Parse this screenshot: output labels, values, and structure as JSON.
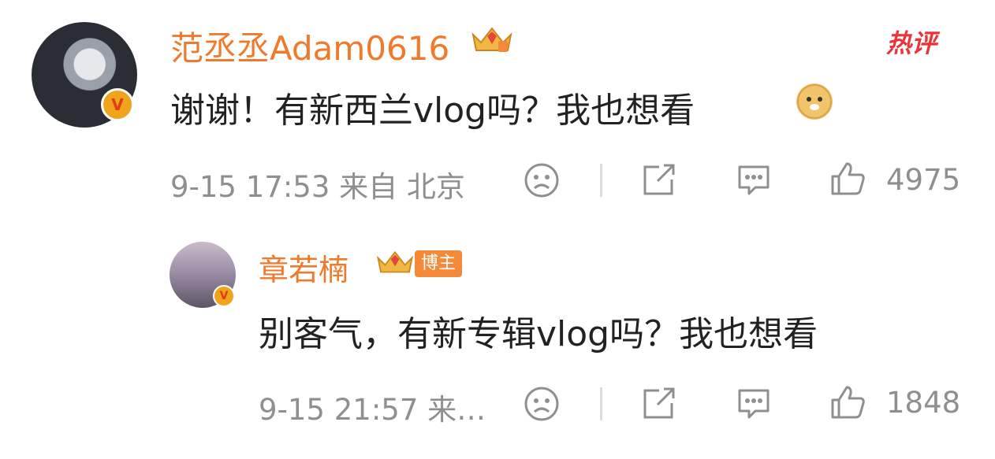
{
  "comments": [
    {
      "username": "范丞丞Adam0616",
      "hot_label": "热评",
      "content": "谢谢！有新西兰vlog吗？我也想看",
      "emoji_icon": "doge-emoji-icon",
      "time_location": "9-15 17:53 来自 北京",
      "likes": "4975"
    },
    {
      "username": "章若楠",
      "badge": "博主",
      "content": "别客气，有新专辑vlog吗？我也想看",
      "time_location": "9-15 21:57 来…",
      "likes": "1848"
    }
  ],
  "colors": {
    "username": "#f0792b",
    "hot": "#e8353a",
    "meta": "#8f8f8f",
    "content": "#222222"
  },
  "verified_glyph": "V"
}
